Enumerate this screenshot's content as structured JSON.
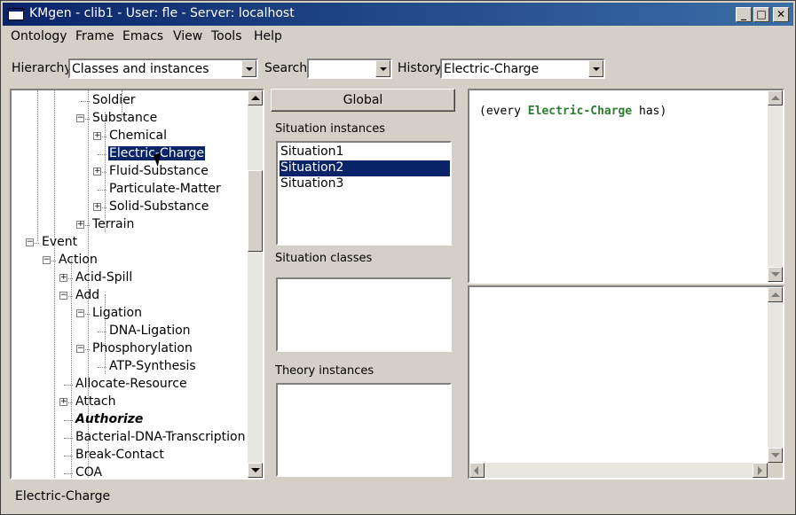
{
  "window": {
    "title": "KMgen  - clib1 - User: fle - Server: localhost"
  },
  "menu": [
    "Ontology",
    "Frame",
    "Emacs",
    "View",
    "Tools",
    "Help"
  ],
  "toolbar": {
    "hierarchy_label": "Hierarchy",
    "hierarchy_value": "Classes and instances",
    "search_label": "Search",
    "search_value": "",
    "history_label": "History",
    "history_value": "Electric-Charge"
  },
  "tree": [
    {
      "label": "Soldier"
    },
    {
      "label": "Substance",
      "expander": "minus"
    },
    {
      "label": "Chemical",
      "expander": "plus"
    },
    {
      "label": "Electric-Charge",
      "selected": true
    },
    {
      "label": "Fluid-Substance",
      "expander": "plus"
    },
    {
      "label": "Particulate-Matter"
    },
    {
      "label": "Solid-Substance",
      "expander": "plus"
    },
    {
      "label": "Terrain",
      "expander": "plus"
    },
    {
      "label": "Event",
      "expander": "minus"
    },
    {
      "label": "Action",
      "expander": "minus"
    },
    {
      "label": "Acid-Spill",
      "expander": "plus"
    },
    {
      "label": "Add",
      "expander": "minus"
    },
    {
      "label": "Ligation",
      "expander": "minus"
    },
    {
      "label": "DNA-Ligation"
    },
    {
      "label": "Phosphorylation",
      "expander": "minus"
    },
    {
      "label": "ATP-Synthesis"
    },
    {
      "label": "Allocate-Resource"
    },
    {
      "label": "Attach",
      "expander": "plus"
    },
    {
      "label": "Authorize",
      "emphasis": true
    },
    {
      "label": "Bacterial-DNA-Transcription"
    },
    {
      "label": "Break-Contact"
    },
    {
      "label": "COA"
    }
  ],
  "middle": {
    "global_button": "Global",
    "situation_instances_label": "Situation instances",
    "situation_instances": [
      "Situation1",
      "Situation2",
      "Situation3"
    ],
    "situation_selected_index": 1,
    "situation_classes_label": "Situation classes",
    "theory_instances_label": "Theory instances"
  },
  "editor": {
    "code_prefix": "(every ",
    "code_keyword": "Electric-Charge",
    "code_suffix": " has)"
  },
  "status": {
    "text": "Electric-Charge"
  },
  "colors": {
    "title_bar": "#0a246a",
    "selection": "#0a246a",
    "keyword": "#2e7d32"
  }
}
